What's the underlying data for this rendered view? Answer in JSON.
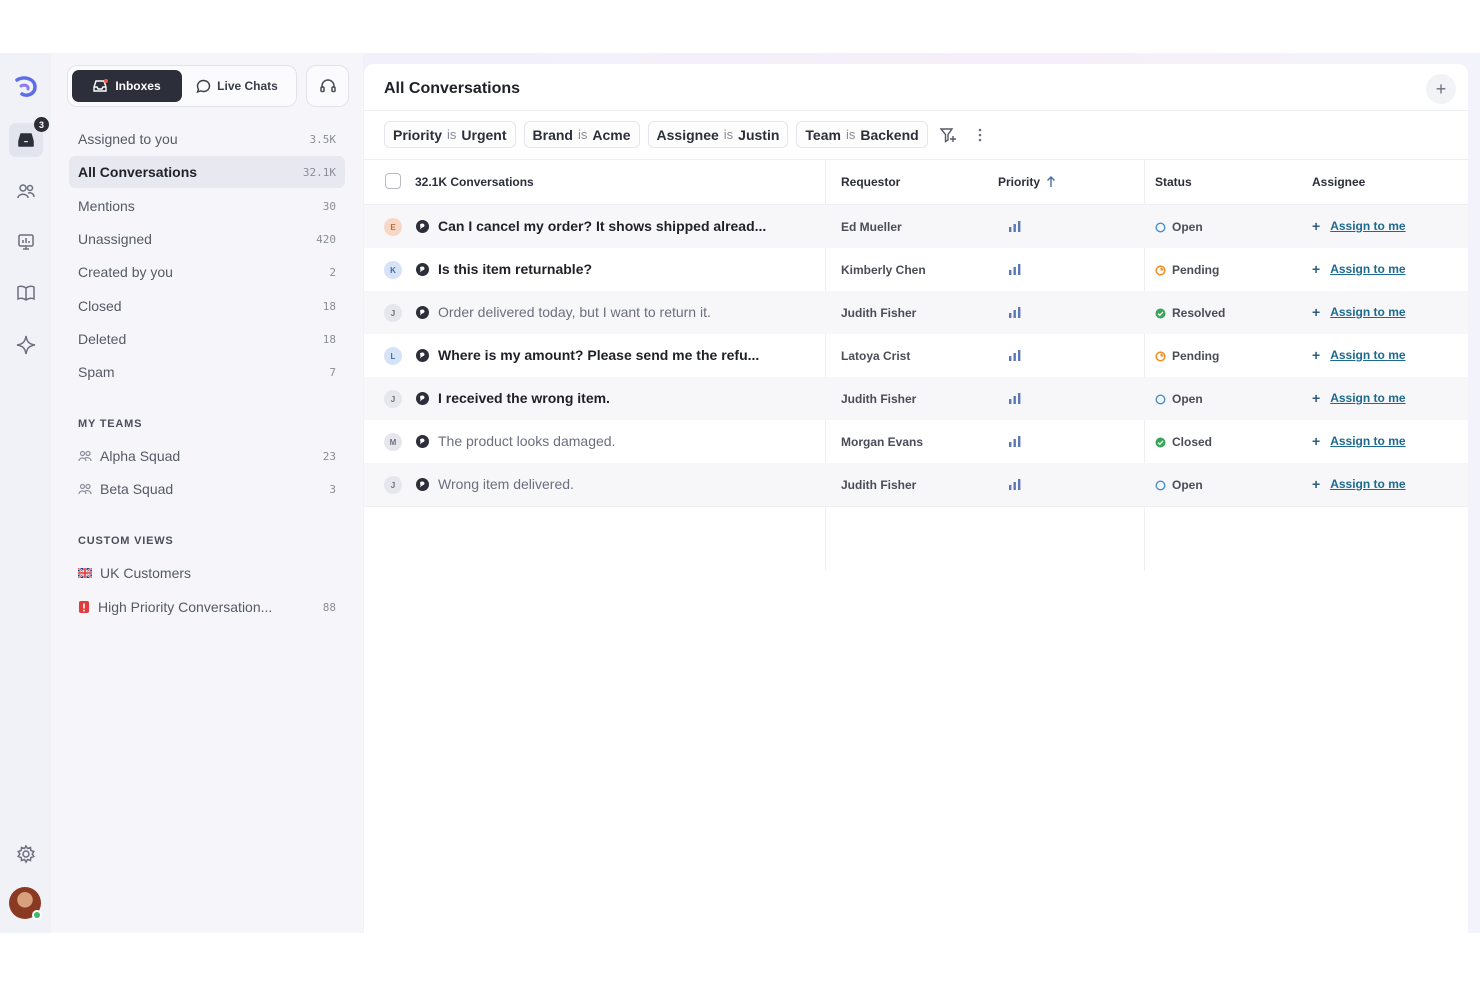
{
  "rail": {
    "inbox_badge": "3"
  },
  "sidebar": {
    "tabs": [
      {
        "label": "Inboxes"
      },
      {
        "label": "Live Chats"
      }
    ],
    "nav": [
      {
        "label": "Assigned to you",
        "count": "3.5K"
      },
      {
        "label": "All Conversations",
        "count": "32.1K"
      },
      {
        "label": "Mentions",
        "count": "30"
      },
      {
        "label": "Unassigned",
        "count": "420"
      },
      {
        "label": "Created by you",
        "count": "2"
      },
      {
        "label": "Closed",
        "count": "18"
      },
      {
        "label": "Deleted",
        "count": "18"
      },
      {
        "label": "Spam",
        "count": "7"
      }
    ],
    "teams_heading": "MY TEAMS",
    "teams": [
      {
        "label": "Alpha Squad",
        "count": "23"
      },
      {
        "label": "Beta Squad",
        "count": "3"
      }
    ],
    "views_heading": "CUSTOM VIEWS",
    "views": [
      {
        "label": "UK Customers",
        "count": "",
        "icon": "uk-flag-icon"
      },
      {
        "label": "High Priority Conversation...",
        "count": "88",
        "icon": "alert-icon"
      }
    ]
  },
  "main": {
    "title": "All Conversations",
    "filters": [
      {
        "key": "Priority",
        "op": "is",
        "value": "Urgent"
      },
      {
        "key": "Brand",
        "op": "is",
        "value": "Acme"
      },
      {
        "key": "Assignee",
        "op": "is",
        "value": "Justin"
      },
      {
        "key": "Team",
        "op": "is",
        "value": "Backend"
      }
    ],
    "columns": {
      "count": "32.1K",
      "conversations": "Conversations",
      "requestor": "Requestor",
      "priority": "Priority",
      "status": "Status",
      "assignee": "Assignee"
    },
    "rows": [
      {
        "initial": "E",
        "subject": "Can I cancel my order? It shows shipped alread...",
        "unread": true,
        "requestor": "Ed Mueller",
        "status": "Open",
        "status_type": "open",
        "assign": "Assign to me",
        "ini_color": "#f6d8c4",
        "ini_text": "#c06a3a"
      },
      {
        "initial": "K",
        "subject": "Is this item returnable?",
        "unread": true,
        "requestor": "Kimberly Chen",
        "status": "Pending",
        "status_type": "pending",
        "assign": "Assign to me",
        "ini_color": "#d6e3f7",
        "ini_text": "#3d6bb5"
      },
      {
        "initial": "J",
        "subject": "Order delivered today, but I want to return it.",
        "unread": false,
        "requestor": "Judith Fisher",
        "status": "Resolved",
        "status_type": "done",
        "assign": "Assign to me",
        "ini_color": "#e6e7ec",
        "ini_text": "#6b6f7e"
      },
      {
        "initial": "L",
        "subject": "Where is my amount? Please send me the refu...",
        "unread": true,
        "requestor": "Latoya Crist",
        "status": "Pending",
        "status_type": "pending",
        "assign": "Assign to me",
        "ini_color": "#d6e3f7",
        "ini_text": "#3d6bb5"
      },
      {
        "initial": "J",
        "subject": "I received the wrong item.",
        "unread": true,
        "requestor": "Judith Fisher",
        "status": "Open",
        "status_type": "open",
        "assign": "Assign to me",
        "ini_color": "#e6e7ec",
        "ini_text": "#6b6f7e"
      },
      {
        "initial": "M",
        "subject": "The product looks damaged.",
        "unread": false,
        "requestor": "Morgan Evans",
        "status": "Closed",
        "status_type": "done",
        "assign": "Assign to me",
        "ini_color": "#e6e7ec",
        "ini_text": "#6b6f7e"
      },
      {
        "initial": "J",
        "subject": "Wrong item delivered.",
        "unread": false,
        "requestor": "Judith Fisher",
        "status": "Open",
        "status_type": "open",
        "assign": "Assign to me",
        "ini_color": "#e6e7ec",
        "ini_text": "#6b6f7e"
      }
    ]
  },
  "colors": {
    "open": "#4a90c8",
    "pending": "#f0922b",
    "done": "#3aa45a",
    "accent": "#2c2f3a",
    "link": "#1d6a8f"
  }
}
